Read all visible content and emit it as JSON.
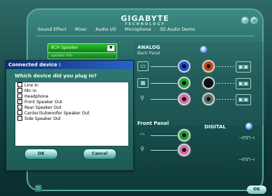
{
  "brand": {
    "logo": "GIGABYTE",
    "tagline": "TECHNOLOGY"
  },
  "tabs": [
    "Sound Effect",
    "Mixer",
    "Audio I/O",
    "Microphone",
    "3D Audio Demo"
  ],
  "active_tab": "Audio I/O",
  "speaker_select": {
    "value": "8CH Speaker",
    "option_hint": "speaker info"
  },
  "panels": {
    "analog": {
      "title": "ANALOG",
      "subtitle": "Back Panel"
    },
    "front": {
      "title": "Front Panel"
    },
    "digital": {
      "title": "DIGITAL"
    }
  },
  "jacks": {
    "back": [
      "blue",
      "green",
      "pink",
      "orange",
      "black",
      "gray"
    ],
    "front": [
      "green",
      "pink"
    ]
  },
  "colors": {
    "blue": "#1a4ed6",
    "green": "#1fa12f",
    "pink": "#e06aa6",
    "orange": "#c24a12",
    "black": "#111111",
    "gray": "#5f6f6d"
  },
  "dialog": {
    "title": "Connected device :",
    "question": "Which device did you plug in?",
    "options": [
      {
        "label": "Line In",
        "checked": false
      },
      {
        "label": "Mic In",
        "checked": false
      },
      {
        "label": "Headphone",
        "checked": false
      },
      {
        "label": "Front Speaker Out",
        "checked": true
      },
      {
        "label": "Rear Speaker Out",
        "checked": false
      },
      {
        "label": "Center/Subwoofer Speaker Out",
        "checked": false
      },
      {
        "label": "Side Speaker Out",
        "checked": false
      }
    ],
    "ok_label": "OK",
    "cancel_label": "Cancel"
  },
  "footer": {
    "ok_label": "OK"
  }
}
